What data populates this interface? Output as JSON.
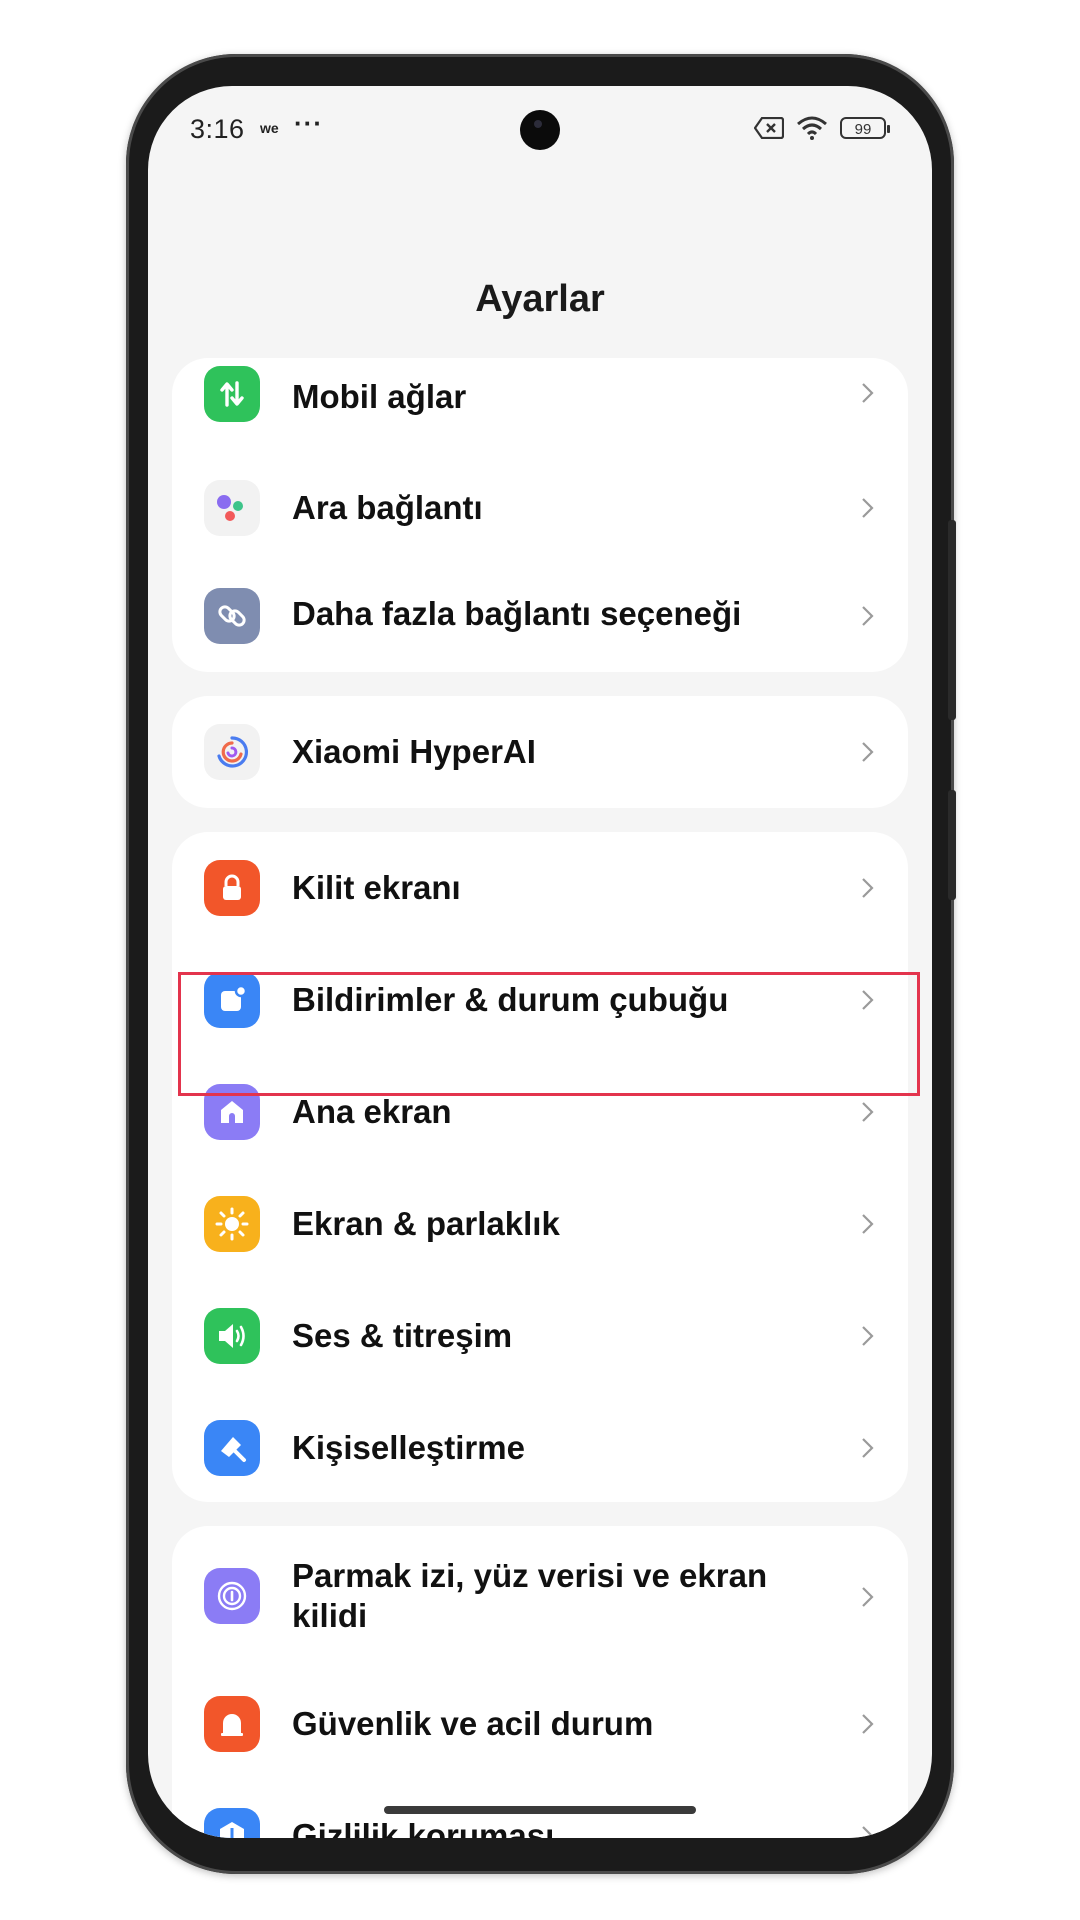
{
  "status_bar": {
    "time": "3:16",
    "carrier_badge": "we",
    "more": "···",
    "battery": "99"
  },
  "header": {
    "title": "Ayarlar"
  },
  "sections": [
    {
      "items": [
        {
          "label": "Mobil ağlar",
          "icon": "mobile-data-icon",
          "color": "#2fc25b"
        },
        {
          "label": "Ara bağlantı",
          "icon": "interconnect-icon",
          "color": "#f2f2f2"
        },
        {
          "label": "Daha fazla bağlantı seçeneği",
          "icon": "link-icon",
          "color": "#7f8db0"
        }
      ]
    },
    {
      "items": [
        {
          "label": "Xiaomi HyperAI",
          "icon": "hyperai-icon",
          "color": "#f2f2f2"
        }
      ]
    },
    {
      "items": [
        {
          "label": "Kilit ekranı",
          "icon": "lock-icon",
          "color": "#f2562a"
        },
        {
          "label": "Bildirimler & durum çubuğu",
          "icon": "notification-icon",
          "color": "#3a86f6"
        },
        {
          "label": "Ana ekran",
          "icon": "home-icon",
          "color": "#8b7cf5"
        },
        {
          "label": "Ekran & parlaklık",
          "icon": "brightness-icon",
          "color": "#f8b11c"
        },
        {
          "label": "Ses & titreşim",
          "icon": "sound-icon",
          "color": "#2fc25b"
        },
        {
          "label": "Kişiselleştirme",
          "icon": "personalization-icon",
          "color": "#3a86f6"
        }
      ]
    },
    {
      "items": [
        {
          "label": "Parmak izi, yüz verisi ve ekran kilidi",
          "icon": "fingerprint-icon",
          "color": "#8b7cf5"
        },
        {
          "label": "Güvenlik ve acil durum",
          "icon": "emergency-icon",
          "color": "#f2562a"
        },
        {
          "label": "Gizlilik koruması",
          "icon": "privacy-icon",
          "color": "#3a86f6"
        }
      ]
    }
  ],
  "highlighted_item": "Ana ekran"
}
